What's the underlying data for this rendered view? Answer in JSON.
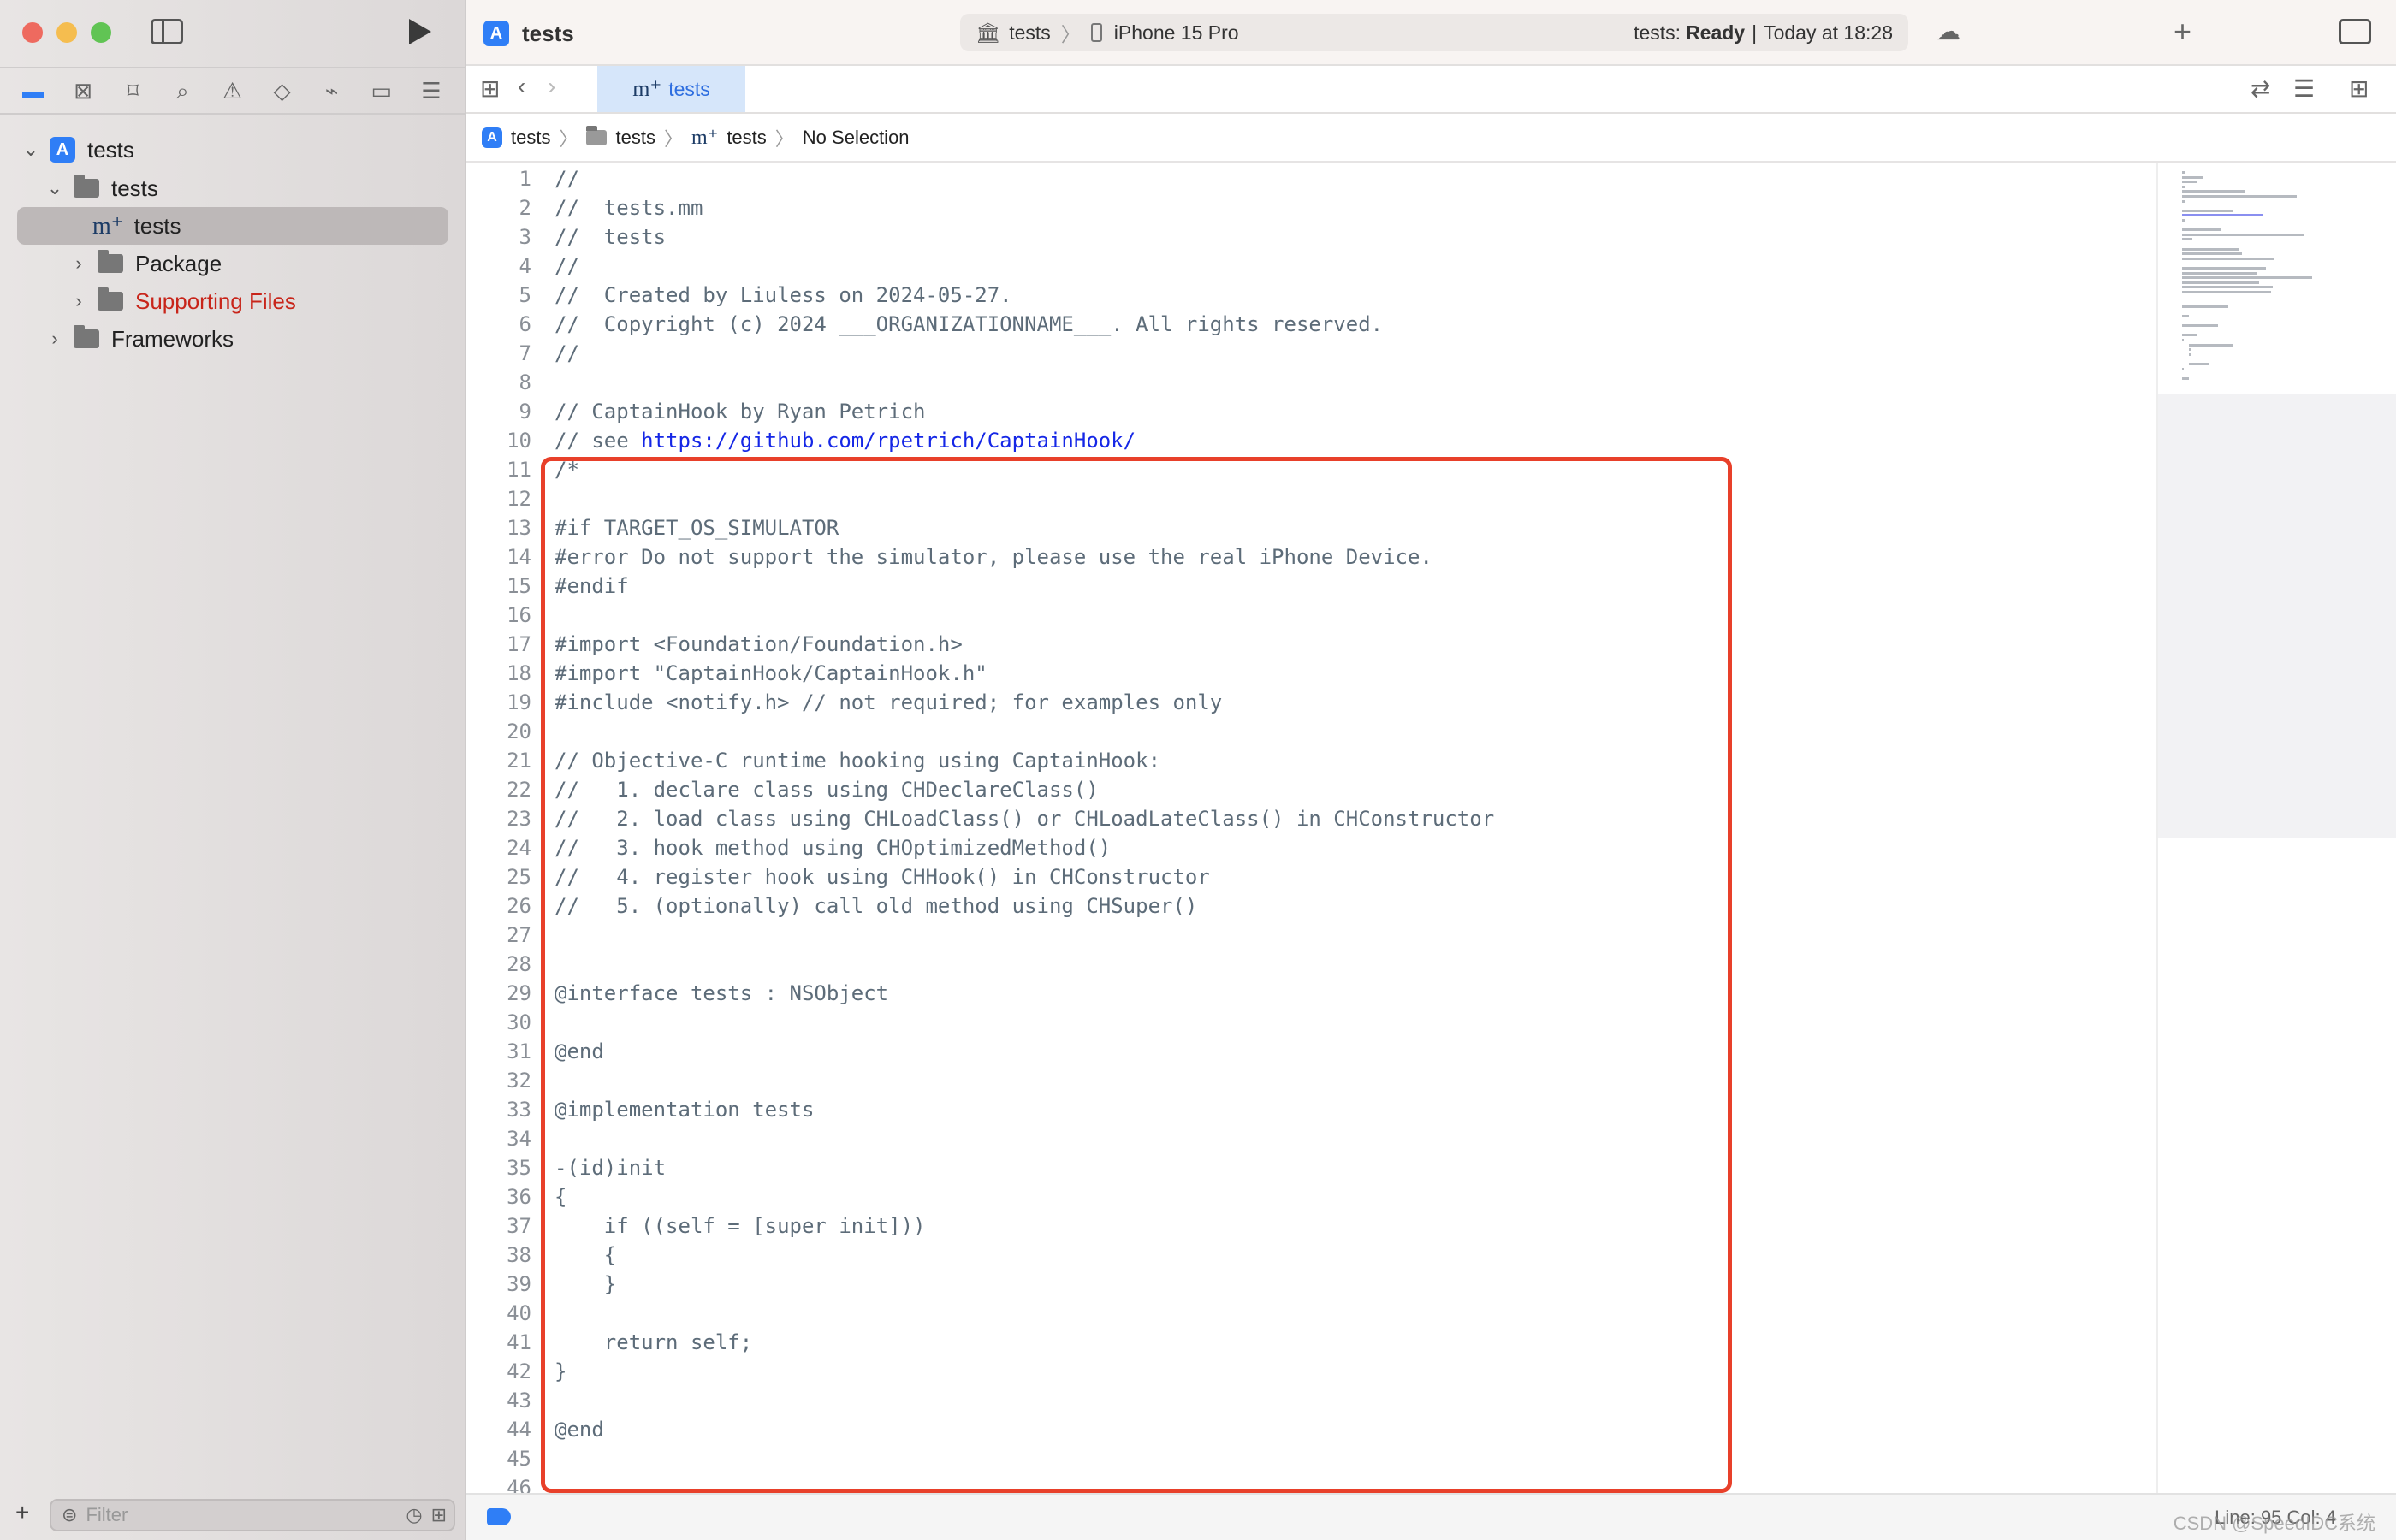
{
  "window": {
    "title": "tests",
    "colors": {
      "close": "#ee6a5f",
      "minimize": "#f5bd4f",
      "zoom": "#61c454",
      "accent": "#2f7ef6",
      "highlight": "#e8402a"
    }
  },
  "toolbar": {
    "scheme": "tests",
    "device": "iPhone 15 Pro",
    "status_prefix": "tests:",
    "status_state": "Ready",
    "status_time": "Today at 18:28"
  },
  "navigator": {
    "icons": [
      "folder-icon",
      "source-control-icon",
      "bookmark-icon",
      "search-icon",
      "warning-icon",
      "test-icon",
      "debug-icon",
      "breakpoint-icon",
      "report-icon"
    ],
    "tree": [
      {
        "label": "tests",
        "kind": "project"
      },
      {
        "label": "tests",
        "kind": "folder"
      },
      {
        "label": "tests",
        "kind": "file",
        "badge": "m⁺"
      },
      {
        "label": "Package",
        "kind": "folder"
      },
      {
        "label": "Supporting Files",
        "kind": "folder",
        "color": "#c8251a"
      },
      {
        "label": "Frameworks",
        "kind": "folder"
      }
    ],
    "filter_placeholder": "Filter"
  },
  "tab": {
    "badge": "m⁺",
    "label": "tests"
  },
  "breadcrumb": [
    "tests",
    "tests",
    "tests",
    "No Selection"
  ],
  "editor": {
    "lines": [
      {
        "text": "//"
      },
      {
        "text": "//  tests.mm"
      },
      {
        "text": "//  tests"
      },
      {
        "text": "//"
      },
      {
        "text": "//  Created by Liuless on 2024-05-27."
      },
      {
        "text": "//  Copyright (c) 2024 ___ORGANIZATIONNAME___. All rights reserved."
      },
      {
        "text": "//"
      },
      {
        "text": ""
      },
      {
        "text": "// CaptainHook by Ryan Petrich"
      },
      {
        "text": "// see ",
        "link": "https://github.com/rpetrich/CaptainHook/"
      },
      {
        "text": "/*"
      },
      {
        "text": ""
      },
      {
        "text": "#if TARGET_OS_SIMULATOR"
      },
      {
        "text": "#error Do not support the simulator, please use the real iPhone Device."
      },
      {
        "text": "#endif"
      },
      {
        "text": ""
      },
      {
        "text": "#import <Foundation/Foundation.h>"
      },
      {
        "text": "#import \"CaptainHook/CaptainHook.h\""
      },
      {
        "text": "#include <notify.h> // not required; for examples only"
      },
      {
        "text": ""
      },
      {
        "text": "// Objective-C runtime hooking using CaptainHook:"
      },
      {
        "text": "//   1. declare class using CHDeclareClass()"
      },
      {
        "text": "//   2. load class using CHLoadClass() or CHLoadLateClass() in CHConstructor"
      },
      {
        "text": "//   3. hook method using CHOptimizedMethod()"
      },
      {
        "text": "//   4. register hook using CHHook() in CHConstructor"
      },
      {
        "text": "//   5. (optionally) call old method using CHSuper()"
      },
      {
        "text": ""
      },
      {
        "text": ""
      },
      {
        "text": "@interface tests : NSObject"
      },
      {
        "text": ""
      },
      {
        "text": "@end"
      },
      {
        "text": ""
      },
      {
        "text": "@implementation tests"
      },
      {
        "text": ""
      },
      {
        "text": "-(id)init"
      },
      {
        "text": "{"
      },
      {
        "text": "    if ((self = [super init]))"
      },
      {
        "text": "    {"
      },
      {
        "text": "    }"
      },
      {
        "text": ""
      },
      {
        "text": "    return self;"
      },
      {
        "text": "}"
      },
      {
        "text": ""
      },
      {
        "text": "@end"
      },
      {
        "text": ""
      },
      {
        "text": ""
      }
    ]
  },
  "footer": {
    "status": "Line: 95  Col: 4",
    "watermark": "CSDN @SpeedIDC系统"
  }
}
